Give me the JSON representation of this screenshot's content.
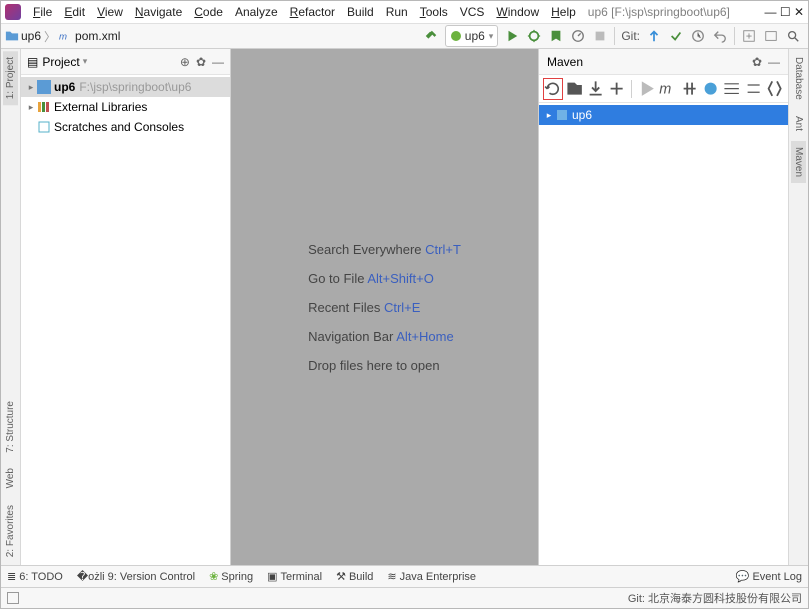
{
  "title": {
    "path": "up6 [F:\\jsp\\springboot\\up6]"
  },
  "menus": {
    "file": "File",
    "edit": "Edit",
    "view": "View",
    "navigate": "Navigate",
    "code": "Code",
    "analyze": "Analyze",
    "refactor": "Refactor",
    "build": "Build",
    "run": "Run",
    "tools": "Tools",
    "vcs": "VCS",
    "window": "Window",
    "help": "Help"
  },
  "breadcrumb": {
    "root": "up6",
    "file": "pom.xml"
  },
  "runconfig": {
    "name": "up6"
  },
  "toolbar": {
    "git_label": "Git:"
  },
  "left_tabs": {
    "project": "1: Project",
    "structure": "7: Structure",
    "web": "Web",
    "favorites": "2: Favorites"
  },
  "right_tabs": {
    "database": "Database",
    "ant": "Ant",
    "maven": "Maven"
  },
  "project_panel": {
    "title": "Project",
    "root": {
      "name": "up6",
      "path": "F:\\jsp\\springboot\\up6"
    },
    "ext_lib": "External Libraries",
    "scratches": "Scratches and Consoles"
  },
  "tips": {
    "search": {
      "label": "Search Everywhere",
      "shortcut": "Ctrl+T"
    },
    "gotofile": {
      "label": "Go to File",
      "shortcut": "Alt+Shift+O"
    },
    "recent": {
      "label": "Recent Files",
      "shortcut": "Ctrl+E"
    },
    "navbar": {
      "label": "Navigation Bar",
      "shortcut": "Alt+Home"
    },
    "drop": "Drop files here to open"
  },
  "maven": {
    "title": "Maven",
    "root": "up6"
  },
  "bottom": {
    "todo": "6: TODO",
    "vcs": "9: Version Control",
    "spring": "Spring",
    "terminal": "Terminal",
    "build": "Build",
    "jee": "Java Enterprise",
    "eventlog": "Event Log"
  },
  "status": {
    "git": "Git: 北京海泰方圆科技股份有限公司"
  }
}
